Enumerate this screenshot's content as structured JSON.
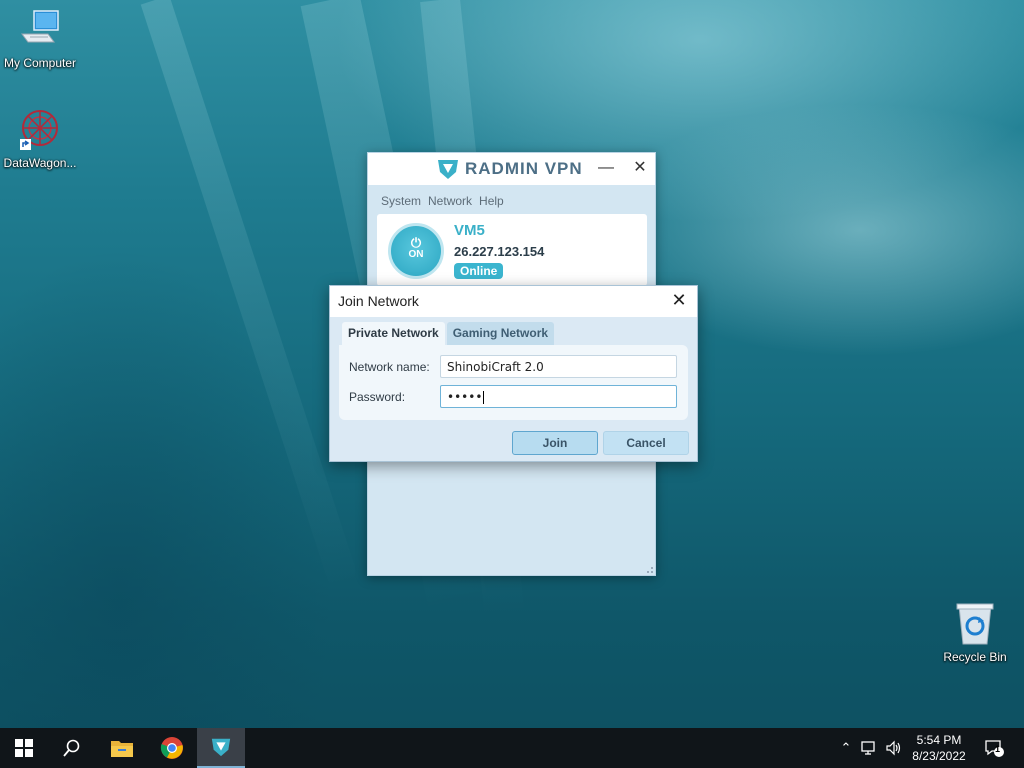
{
  "desktop": {
    "icons": [
      {
        "label": "My Computer",
        "icon": "monitor-icon"
      },
      {
        "label": "DataWagon...",
        "icon": "datawagon-shortcut-icon"
      },
      {
        "label": "Recycle Bin",
        "icon": "recycle-bin-icon"
      }
    ]
  },
  "radmin": {
    "brand": "RADMIN VPN",
    "menu": [
      "System",
      "Network",
      "Help"
    ],
    "power_label": "ON",
    "computer_name": "VM5",
    "ip_address": "26.227.123.154",
    "status": "Online"
  },
  "join_dialog": {
    "title": "Join Network",
    "tabs": [
      {
        "label": "Private Network",
        "active": true
      },
      {
        "label": "Gaming Network",
        "active": false
      }
    ],
    "network_name_label": "Network name:",
    "network_name_value": "ShinobiCraft 2.0",
    "password_label": "Password:",
    "password_value": "•••••",
    "join_label": "Join",
    "cancel_label": "Cancel"
  },
  "taskbar": {
    "items": [
      "windows-start-icon",
      "search-icon",
      "file-explorer-icon",
      "chrome-icon",
      "radmin-vpn-icon"
    ],
    "active_item": "radmin-vpn-icon",
    "time": "5:54 PM",
    "date": "8/23/2022",
    "notification_count": "1"
  },
  "colors": {
    "accent": "#3ab0c8",
    "dialog_bg": "#dbe9f4",
    "taskbar_bg": "#101519"
  }
}
